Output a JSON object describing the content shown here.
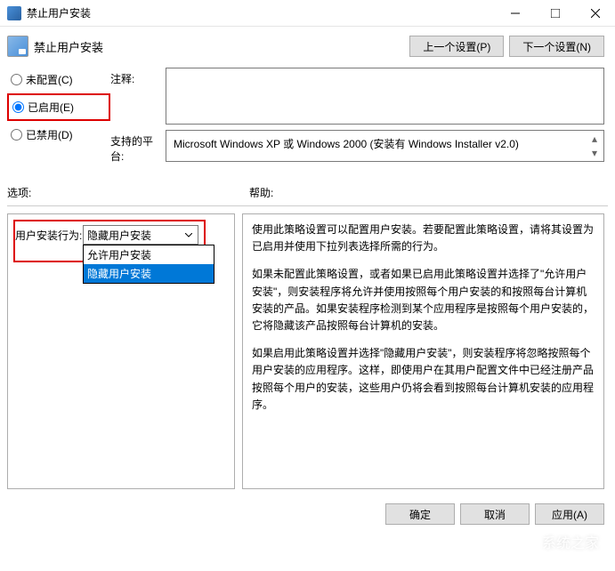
{
  "titlebar": {
    "title": "禁止用户安装"
  },
  "header": {
    "title": "禁止用户安装",
    "prev_btn": "上一个设置(P)",
    "next_btn": "下一个设置(N)"
  },
  "radio": {
    "not_configured": "未配置(C)",
    "enabled": "已启用(E)",
    "disabled": "已禁用(D)"
  },
  "meta": {
    "comment_label": "注释:",
    "platform_label": "支持的平台:",
    "platform_text": "Microsoft Windows XP 或 Windows 2000 (安装有 Windows Installer v2.0)"
  },
  "section_labels": {
    "options": "选项:",
    "help": "帮助:"
  },
  "options": {
    "behavior_label": "用户安装行为:",
    "combo_value": "隐藏用户安装",
    "dropdown": {
      "item1": "允许用户安装",
      "item2": "隐藏用户安装"
    }
  },
  "help": {
    "p1": "使用此策略设置可以配置用户安装。若要配置此策略设置，请将其设置为已启用并使用下拉列表选择所需的行为。",
    "p2": "如果未配置此策略设置，或者如果已启用此策略设置并选择了\"允许用户安装\"，则安装程序将允许并使用按照每个用户安装的和按照每台计算机安装的产品。如果安装程序检测到某个应用程序是按照每个用户安装的，它将隐藏该产品按照每台计算机的安装。",
    "p3": "如果启用此策略设置并选择\"隐藏用户安装\"，则安装程序将忽略按照每个用户安装的应用程序。这样，即使用户在其用户配置文件中已经注册产品按照每个用户的安装，这些用户仍将会看到按照每台计算机安装的应用程序。"
  },
  "buttons": {
    "ok": "确定",
    "cancel": "取消",
    "apply": "应用(A)"
  },
  "watermark": "系统之家"
}
